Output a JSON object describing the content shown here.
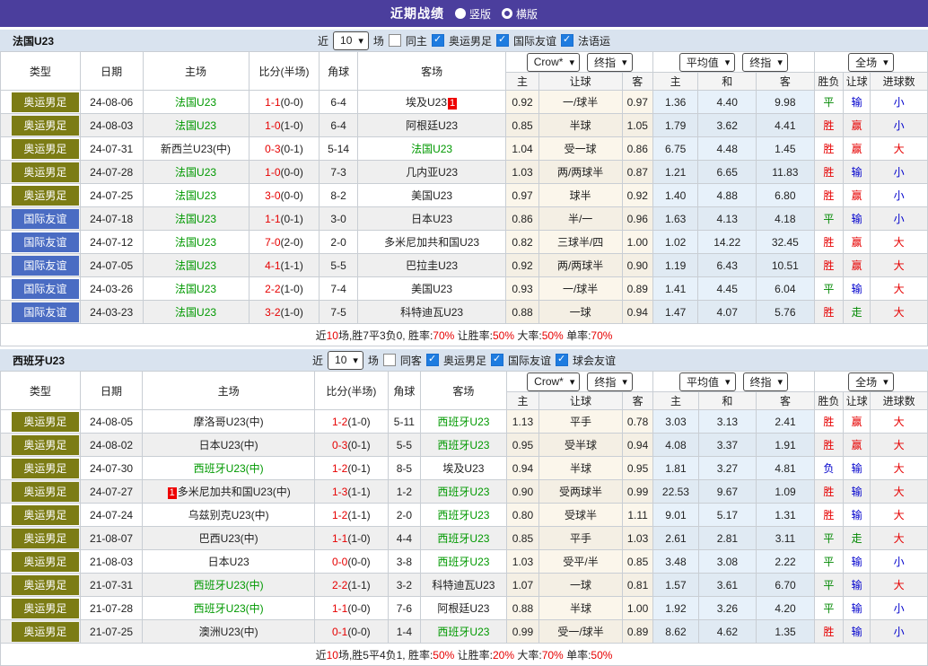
{
  "banner": {
    "title": "近期战绩",
    "options": [
      {
        "label": "竖版",
        "selected": true
      },
      {
        "label": "横版",
        "selected": false
      }
    ]
  },
  "controls": {
    "near": "近",
    "count": "10",
    "matches": "场"
  },
  "headers": {
    "type": "类型",
    "date": "日期",
    "home": "主场",
    "score": "比分(半场)",
    "corner": "角球",
    "away": "客场",
    "odds_home": "主",
    "odds_handicap": "让球",
    "odds_away": "客",
    "avg_home": "主",
    "avg_draw": "和",
    "avg_away": "客",
    "result_wdl": "胜负",
    "result_handicap": "让球",
    "result_goals": "进球数",
    "dd_crow": "Crow*",
    "dd_final": "终指",
    "dd_avg": "平均值",
    "dd_final2": "终指",
    "dd_full": "全场"
  },
  "result_colors": {
    "胜": "#e60000",
    "平": "#008800",
    "负": "#0000cc",
    "赢": "#e60000",
    "输": "#0000cc",
    "走": "#008800",
    "大": "#e60000",
    "小": "#0000cc"
  },
  "type_colors": {
    "奥运男足": "#7c7c15",
    "国际友谊": "#4a6cc3"
  },
  "sections": [
    {
      "team": "法国U23",
      "same_label": "同主",
      "checkboxes": [
        "奥运男足",
        "国际友谊",
        "法语运"
      ],
      "rows": [
        {
          "type": "奥运男足",
          "date": "24-08-06",
          "home": "法国U23",
          "ht": true,
          "badge": "away",
          "score": "1-1",
          "half": "(0-0)",
          "corner": "6-4",
          "away": "埃及U23",
          "at": false,
          "let": [
            "0.92",
            "一/球半",
            "0.97"
          ],
          "avg": [
            "1.36",
            "4.40",
            "9.98"
          ],
          "res": [
            "平",
            "输",
            "小"
          ]
        },
        {
          "type": "奥运男足",
          "date": "24-08-03",
          "home": "法国U23",
          "ht": true,
          "badge": null,
          "score": "1-0",
          "half": "(1-0)",
          "corner": "6-4",
          "away": "阿根廷U23",
          "at": false,
          "let": [
            "0.85",
            "半球",
            "1.05"
          ],
          "avg": [
            "1.79",
            "3.62",
            "4.41"
          ],
          "res": [
            "胜",
            "赢",
            "小"
          ]
        },
        {
          "type": "奥运男足",
          "date": "24-07-31",
          "home": "新西兰U23(中)",
          "ht": false,
          "badge": null,
          "score": "0-3",
          "half": "(0-1)",
          "corner": "5-14",
          "away": "法国U23",
          "at": true,
          "let": [
            "1.04",
            "受一球",
            "0.86"
          ],
          "avg": [
            "6.75",
            "4.48",
            "1.45"
          ],
          "res": [
            "胜",
            "赢",
            "大"
          ]
        },
        {
          "type": "奥运男足",
          "date": "24-07-28",
          "home": "法国U23",
          "ht": true,
          "badge": null,
          "score": "1-0",
          "half": "(0-0)",
          "corner": "7-3",
          "away": "几内亚U23",
          "at": false,
          "let": [
            "1.03",
            "两/两球半",
            "0.87"
          ],
          "avg": [
            "1.21",
            "6.65",
            "11.83"
          ],
          "res": [
            "胜",
            "输",
            "小"
          ]
        },
        {
          "type": "奥运男足",
          "date": "24-07-25",
          "home": "法国U23",
          "ht": true,
          "badge": null,
          "score": "3-0",
          "half": "(0-0)",
          "corner": "8-2",
          "away": "美国U23",
          "at": false,
          "let": [
            "0.97",
            "球半",
            "0.92"
          ],
          "avg": [
            "1.40",
            "4.88",
            "6.80"
          ],
          "res": [
            "胜",
            "赢",
            "小"
          ]
        },
        {
          "type": "国际友谊",
          "date": "24-07-18",
          "home": "法国U23",
          "ht": true,
          "badge": null,
          "score": "1-1",
          "half": "(0-1)",
          "corner": "3-0",
          "away": "日本U23",
          "at": false,
          "let": [
            "0.86",
            "半/一",
            "0.96"
          ],
          "avg": [
            "1.63",
            "4.13",
            "4.18"
          ],
          "res": [
            "平",
            "输",
            "小"
          ]
        },
        {
          "type": "国际友谊",
          "date": "24-07-12",
          "home": "法国U23",
          "ht": true,
          "badge": null,
          "score": "7-0",
          "half": "(2-0)",
          "corner": "2-0",
          "away": "多米尼加共和国U23",
          "at": false,
          "let": [
            "0.82",
            "三球半/四",
            "1.00"
          ],
          "avg": [
            "1.02",
            "14.22",
            "32.45"
          ],
          "res": [
            "胜",
            "赢",
            "大"
          ]
        },
        {
          "type": "国际友谊",
          "date": "24-07-05",
          "home": "法国U23",
          "ht": true,
          "badge": null,
          "score": "4-1",
          "half": "(1-1)",
          "corner": "5-5",
          "away": "巴拉圭U23",
          "at": false,
          "let": [
            "0.92",
            "两/两球半",
            "0.90"
          ],
          "avg": [
            "1.19",
            "6.43",
            "10.51"
          ],
          "res": [
            "胜",
            "赢",
            "大"
          ]
        },
        {
          "type": "国际友谊",
          "date": "24-03-26",
          "home": "法国U23",
          "ht": true,
          "badge": null,
          "score": "2-2",
          "half": "(1-0)",
          "corner": "7-4",
          "away": "美国U23",
          "at": false,
          "let": [
            "0.93",
            "一/球半",
            "0.89"
          ],
          "avg": [
            "1.41",
            "4.45",
            "6.04"
          ],
          "res": [
            "平",
            "输",
            "大"
          ]
        },
        {
          "type": "国际友谊",
          "date": "24-03-23",
          "home": "法国U23",
          "ht": true,
          "badge": null,
          "score": "3-2",
          "half": "(1-0)",
          "corner": "7-5",
          "away": "科特迪瓦U23",
          "at": false,
          "let": [
            "0.88",
            "一球",
            "0.94"
          ],
          "avg": [
            "1.47",
            "4.07",
            "5.76"
          ],
          "res": [
            "胜",
            "走",
            "大"
          ]
        }
      ],
      "summary": [
        {
          "t": "近"
        },
        {
          "t": "10",
          "r": 1
        },
        {
          "t": "场,胜7平3负0, 胜率:"
        },
        {
          "t": "70%",
          "r": 1
        },
        {
          "t": " 让胜率:"
        },
        {
          "t": "50%",
          "r": 1
        },
        {
          "t": " 大率:"
        },
        {
          "t": "50%",
          "r": 1
        },
        {
          "t": " 单率:"
        },
        {
          "t": "70%",
          "r": 1
        }
      ]
    },
    {
      "team": "西班牙U23",
      "same_label": "同客",
      "checkboxes": [
        "奥运男足",
        "国际友谊",
        "球会友谊"
      ],
      "rows": [
        {
          "type": "奥运男足",
          "date": "24-08-05",
          "home": "摩洛哥U23(中)",
          "ht": false,
          "badge": null,
          "score": "1-2",
          "half": "(1-0)",
          "corner": "5-11",
          "away": "西班牙U23",
          "at": true,
          "let": [
            "1.13",
            "平手",
            "0.78"
          ],
          "avg": [
            "3.03",
            "3.13",
            "2.41"
          ],
          "res": [
            "胜",
            "赢",
            "大"
          ]
        },
        {
          "type": "奥运男足",
          "date": "24-08-02",
          "home": "日本U23(中)",
          "ht": false,
          "badge": null,
          "score": "0-3",
          "half": "(0-1)",
          "corner": "5-5",
          "away": "西班牙U23",
          "at": true,
          "let": [
            "0.95",
            "受半球",
            "0.94"
          ],
          "avg": [
            "4.08",
            "3.37",
            "1.91"
          ],
          "res": [
            "胜",
            "赢",
            "大"
          ]
        },
        {
          "type": "奥运男足",
          "date": "24-07-30",
          "home": "西班牙U23(中)",
          "ht": true,
          "badge": null,
          "score": "1-2",
          "half": "(0-1)",
          "corner": "8-5",
          "away": "埃及U23",
          "at": false,
          "let": [
            "0.94",
            "半球",
            "0.95"
          ],
          "avg": [
            "1.81",
            "3.27",
            "4.81"
          ],
          "res": [
            "负",
            "输",
            "大"
          ]
        },
        {
          "type": "奥运男足",
          "date": "24-07-27",
          "home": "多米尼加共和国U23(中)",
          "ht": false,
          "badge": "home",
          "score": "1-3",
          "half": "(1-1)",
          "corner": "1-2",
          "away": "西班牙U23",
          "at": true,
          "let": [
            "0.90",
            "受两球半",
            "0.99"
          ],
          "avg": [
            "22.53",
            "9.67",
            "1.09"
          ],
          "res": [
            "胜",
            "输",
            "大"
          ]
        },
        {
          "type": "奥运男足",
          "date": "24-07-24",
          "home": "乌兹别克U23(中)",
          "ht": false,
          "badge": null,
          "score": "1-2",
          "half": "(1-1)",
          "corner": "2-0",
          "away": "西班牙U23",
          "at": true,
          "let": [
            "0.80",
            "受球半",
            "1.11"
          ],
          "avg": [
            "9.01",
            "5.17",
            "1.31"
          ],
          "res": [
            "胜",
            "输",
            "大"
          ]
        },
        {
          "type": "奥运男足",
          "date": "21-08-07",
          "home": "巴西U23(中)",
          "ht": false,
          "badge": null,
          "score": "1-1",
          "half": "(1-0)",
          "corner": "4-4",
          "away": "西班牙U23",
          "at": true,
          "let": [
            "0.85",
            "平手",
            "1.03"
          ],
          "avg": [
            "2.61",
            "2.81",
            "3.11"
          ],
          "res": [
            "平",
            "走",
            "大"
          ]
        },
        {
          "type": "奥运男足",
          "date": "21-08-03",
          "home": "日本U23",
          "ht": false,
          "badge": null,
          "score": "0-0",
          "half": "(0-0)",
          "corner": "3-8",
          "away": "西班牙U23",
          "at": true,
          "let": [
            "1.03",
            "受平/半",
            "0.85"
          ],
          "avg": [
            "3.48",
            "3.08",
            "2.22"
          ],
          "res": [
            "平",
            "输",
            "小"
          ]
        },
        {
          "type": "奥运男足",
          "date": "21-07-31",
          "home": "西班牙U23(中)",
          "ht": true,
          "badge": null,
          "score": "2-2",
          "half": "(1-1)",
          "corner": "3-2",
          "away": "科特迪瓦U23",
          "at": false,
          "let": [
            "1.07",
            "一球",
            "0.81"
          ],
          "avg": [
            "1.57",
            "3.61",
            "6.70"
          ],
          "res": [
            "平",
            "输",
            "大"
          ]
        },
        {
          "type": "奥运男足",
          "date": "21-07-28",
          "home": "西班牙U23(中)",
          "ht": true,
          "badge": null,
          "score": "1-1",
          "half": "(0-0)",
          "corner": "7-6",
          "away": "阿根廷U23",
          "at": false,
          "let": [
            "0.88",
            "半球",
            "1.00"
          ],
          "avg": [
            "1.92",
            "3.26",
            "4.20"
          ],
          "res": [
            "平",
            "输",
            "小"
          ]
        },
        {
          "type": "奥运男足",
          "date": "21-07-25",
          "home": "澳洲U23(中)",
          "ht": false,
          "badge": null,
          "score": "0-1",
          "half": "(0-0)",
          "corner": "1-4",
          "away": "西班牙U23",
          "at": true,
          "let": [
            "0.99",
            "受一/球半",
            "0.89"
          ],
          "avg": [
            "8.62",
            "4.62",
            "1.35"
          ],
          "res": [
            "胜",
            "输",
            "小"
          ]
        }
      ],
      "summary": [
        {
          "t": "近"
        },
        {
          "t": "10",
          "r": 1
        },
        {
          "t": "场,胜5平4负1, 胜率:"
        },
        {
          "t": "50%",
          "r": 1
        },
        {
          "t": " 让胜率:"
        },
        {
          "t": "20%",
          "r": 1
        },
        {
          "t": " 大率:"
        },
        {
          "t": "70%",
          "r": 1
        },
        {
          "t": " 单率:"
        },
        {
          "t": "50%",
          "r": 1
        }
      ]
    }
  ]
}
